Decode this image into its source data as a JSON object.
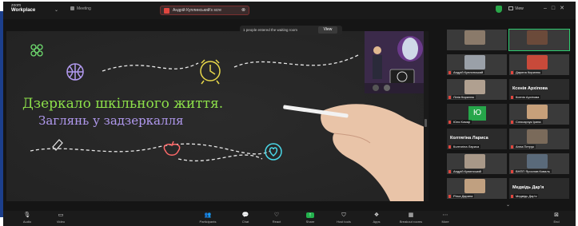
{
  "topbar": {
    "logo_small": "zoom",
    "logo_main": "Workplace",
    "meeting_label": "Meeting",
    "share_notice": "Андрій Куплинський's scre",
    "view_label": "View"
  },
  "waiting_room": {
    "message": "1 people entered the waiting room",
    "view_button": "View"
  },
  "slide": {
    "title_line1": "Дзеркало шкільного життя.",
    "title_line2": "Заглянь у задзеркалля"
  },
  "gallery": {
    "tiles": [
      {
        "name": "",
        "kind": "photo",
        "color": "#8a7a6a"
      },
      {
        "name": "",
        "kind": "photo",
        "color": "#6b4a3a",
        "highlight": true
      },
      {
        "name": "Андрій Куплинський",
        "kind": "photo",
        "color": "#9aa0a8"
      },
      {
        "name": "Дарина Кирилюк",
        "kind": "photo",
        "color": "#c84a3a"
      },
      {
        "name": "Лілія Кирилюк",
        "kind": "photo",
        "color": "#b0a090"
      },
      {
        "name": "Ксенія Архіпова",
        "kind": "name",
        "big": "Ксенія Архіпова"
      },
      {
        "name": "Юля Комар",
        "kind": "initial",
        "initial": "Ю"
      },
      {
        "name": "Слюсарчук Ірина",
        "kind": "photo",
        "color": "#c7a07a"
      },
      {
        "name": "Колтягіна Лариса",
        "kind": "name",
        "big": "Колтягіна Лариса"
      },
      {
        "name": "Анна Петрук",
        "kind": "photo",
        "color": "#7a6a5a"
      },
      {
        "name": "Андрій Купинський",
        "kind": "photo",
        "color": "#a89888"
      },
      {
        "name": "ВНПП Ярослав Коваль",
        "kind": "photo",
        "color": "#5a6a7a"
      },
      {
        "name": "Рітка Дарина",
        "kind": "photo",
        "color": "#c0a080"
      },
      {
        "name": "Медвідь Дар'я",
        "kind": "name",
        "big": "Медвідь Дар'я"
      }
    ]
  },
  "toolbar": {
    "items": [
      {
        "label": "Audio",
        "icon": "mic-icon"
      },
      {
        "label": "Video",
        "icon": "camera-icon"
      },
      {
        "label": "Participants",
        "icon": "participants-icon"
      },
      {
        "label": "Chat",
        "icon": "chat-icon"
      },
      {
        "label": "React",
        "icon": "react-icon"
      },
      {
        "label": "Share",
        "icon": "share-icon"
      },
      {
        "label": "Host tools",
        "icon": "host-tools-icon"
      },
      {
        "label": "Apps",
        "icon": "apps-icon"
      },
      {
        "label": "Breakout rooms",
        "icon": "breakout-icon"
      },
      {
        "label": "More",
        "icon": "more-icon"
      }
    ],
    "end_label": "End"
  },
  "colors": {
    "accent_green": "#22b14c",
    "alert_red": "#e0463f",
    "chalk_green": "#8de04a",
    "chalk_purple": "#b29af0"
  }
}
